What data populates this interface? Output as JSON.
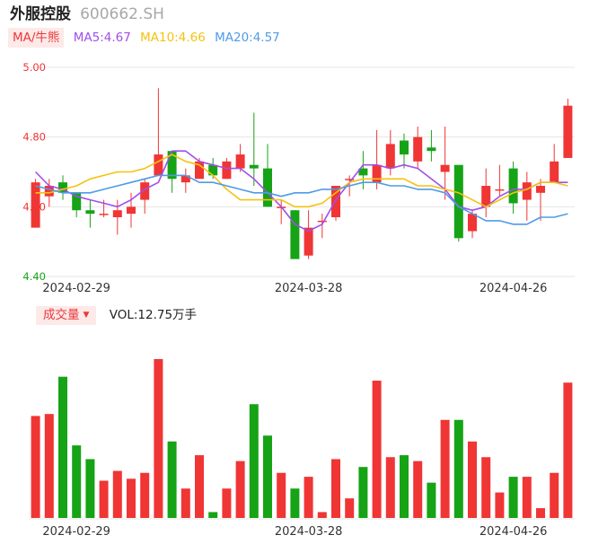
{
  "stock": {
    "name": "外服控股",
    "code": "600662.SH"
  },
  "ma_legend": {
    "button": "MA/牛熊",
    "items": [
      {
        "label": "MA5:4.67",
        "color": "#a24ee8"
      },
      {
        "label": "MA10:4.66",
        "color": "#f5c20f"
      },
      {
        "label": "MA20:4.57",
        "color": "#4e9be8"
      }
    ]
  },
  "volume_legend": {
    "button": "成交量",
    "value_text": "VOL:12.75万手"
  },
  "colors": {
    "up": "#f03535",
    "down": "#16a316",
    "grid": "#e6e6e6"
  },
  "chart_data": [
    {
      "type": "candlestick",
      "y_ticks": [
        "5.00",
        "4.80",
        "4.60",
        "4.40"
      ],
      "ylim": [
        4.4,
        5.0
      ],
      "x_ticks": [
        {
          "index": 3,
          "label": "2024-02-29"
        },
        {
          "index": 20,
          "label": "2024-03-28"
        },
        {
          "index": 35,
          "label": "2024-04-26"
        }
      ],
      "candles": [
        {
          "o": 4.54,
          "c": 4.67,
          "h": 4.68,
          "l": 4.54
        },
        {
          "o": 4.63,
          "c": 4.66,
          "h": 4.68,
          "l": 4.6
        },
        {
          "o": 4.67,
          "c": 4.64,
          "h": 4.69,
          "l": 4.62
        },
        {
          "o": 4.64,
          "c": 4.59,
          "h": 4.64,
          "l": 4.57
        },
        {
          "o": 4.59,
          "c": 4.58,
          "h": 4.62,
          "l": 4.54
        },
        {
          "o": 4.58,
          "c": 4.58,
          "h": 4.62,
          "l": 4.57
        },
        {
          "o": 4.57,
          "c": 4.59,
          "h": 4.62,
          "l": 4.52
        },
        {
          "o": 4.58,
          "c": 4.6,
          "h": 4.64,
          "l": 4.54
        },
        {
          "o": 4.62,
          "c": 4.67,
          "h": 4.68,
          "l": 4.58
        },
        {
          "o": 4.69,
          "c": 4.75,
          "h": 4.94,
          "l": 4.69
        },
        {
          "o": 4.76,
          "c": 4.68,
          "h": 4.76,
          "l": 4.64
        },
        {
          "o": 4.67,
          "c": 4.69,
          "h": 4.71,
          "l": 4.64
        },
        {
          "o": 4.68,
          "c": 4.73,
          "h": 4.74,
          "l": 4.69
        },
        {
          "o": 4.72,
          "c": 4.69,
          "h": 4.74,
          "l": 4.68
        },
        {
          "o": 4.68,
          "c": 4.73,
          "h": 4.74,
          "l": 4.68
        },
        {
          "o": 4.71,
          "c": 4.75,
          "h": 4.78,
          "l": 4.7
        },
        {
          "o": 4.72,
          "c": 4.71,
          "h": 4.87,
          "l": 4.66
        },
        {
          "o": 4.71,
          "c": 4.6,
          "h": 4.78,
          "l": 4.6
        },
        {
          "o": 4.6,
          "c": 4.6,
          "h": 4.62,
          "l": 4.55
        },
        {
          "o": 4.59,
          "c": 4.45,
          "h": 4.59,
          "l": 4.45
        },
        {
          "o": 4.46,
          "c": 4.54,
          "h": 4.59,
          "l": 4.45
        },
        {
          "o": 4.56,
          "c": 4.56,
          "h": 4.58,
          "l": 4.51
        },
        {
          "o": 4.57,
          "c": 4.66,
          "h": 4.66,
          "l": 4.56
        },
        {
          "o": 4.68,
          "c": 4.68,
          "h": 4.69,
          "l": 4.63
        },
        {
          "o": 4.71,
          "c": 4.69,
          "h": 4.76,
          "l": 4.65
        },
        {
          "o": 4.67,
          "c": 4.72,
          "h": 4.82,
          "l": 4.65
        },
        {
          "o": 4.71,
          "c": 4.78,
          "h": 4.82,
          "l": 4.69
        },
        {
          "o": 4.79,
          "c": 4.75,
          "h": 4.81,
          "l": 4.71
        },
        {
          "o": 4.73,
          "c": 4.8,
          "h": 4.83,
          "l": 4.71
        },
        {
          "o": 4.77,
          "c": 4.76,
          "h": 4.82,
          "l": 4.73
        },
        {
          "o": 4.7,
          "c": 4.72,
          "h": 4.83,
          "l": 4.62
        },
        {
          "o": 4.72,
          "c": 4.51,
          "h": 4.72,
          "l": 4.5
        },
        {
          "o": 4.53,
          "c": 4.58,
          "h": 4.59,
          "l": 4.51
        },
        {
          "o": 4.6,
          "c": 4.66,
          "h": 4.71,
          "l": 4.57
        },
        {
          "o": 4.65,
          "c": 4.65,
          "h": 4.72,
          "l": 4.63
        },
        {
          "o": 4.71,
          "c": 4.61,
          "h": 4.73,
          "l": 4.58
        },
        {
          "o": 4.62,
          "c": 4.67,
          "h": 4.7,
          "l": 4.56
        },
        {
          "o": 4.64,
          "c": 4.66,
          "h": 4.68,
          "l": 4.56
        },
        {
          "o": 4.67,
          "c": 4.73,
          "h": 4.78,
          "l": 4.67
        },
        {
          "o": 4.74,
          "c": 4.89,
          "h": 4.91,
          "l": 4.74
        }
      ],
      "ma": {
        "MA5": [
          4.7,
          4.66,
          4.65,
          4.63,
          4.62,
          4.61,
          4.6,
          4.62,
          4.65,
          4.67,
          4.76,
          4.76,
          4.73,
          4.72,
          4.71,
          4.71,
          4.68,
          4.64,
          4.6,
          4.55,
          4.53,
          4.55,
          4.62,
          4.67,
          4.72,
          4.72,
          4.71,
          4.72,
          4.71,
          4.68,
          4.65,
          4.6,
          4.59,
          4.6,
          4.63,
          4.65,
          4.65,
          4.67,
          4.67,
          4.67
        ],
        "MA10": [
          4.64,
          4.64,
          4.65,
          4.66,
          4.68,
          4.69,
          4.7,
          4.7,
          4.71,
          4.73,
          4.75,
          4.73,
          4.72,
          4.69,
          4.65,
          4.62,
          4.62,
          4.62,
          4.62,
          4.6,
          4.6,
          4.61,
          4.64,
          4.67,
          4.68,
          4.68,
          4.68,
          4.68,
          4.66,
          4.66,
          4.65,
          4.64,
          4.62,
          4.6,
          4.62,
          4.64,
          4.65,
          4.67,
          4.67,
          4.66
        ],
        "MA20": [
          4.66,
          4.65,
          4.64,
          4.64,
          4.64,
          4.65,
          4.66,
          4.67,
          4.68,
          4.69,
          4.69,
          4.69,
          4.67,
          4.67,
          4.66,
          4.65,
          4.64,
          4.64,
          4.63,
          4.64,
          4.64,
          4.65,
          4.65,
          4.66,
          4.67,
          4.67,
          4.66,
          4.66,
          4.65,
          4.65,
          4.64,
          4.6,
          4.58,
          4.56,
          4.56,
          4.55,
          4.55,
          4.57,
          4.57,
          4.58
        ]
      }
    },
    {
      "type": "bar",
      "title": "成交量",
      "volumes": [
        5.2,
        5.3,
        7.2,
        3.7,
        3.0,
        1.9,
        2.4,
        2.0,
        2.3,
        8.1,
        3.9,
        1.5,
        3.2,
        0.3,
        1.5,
        2.9,
        5.8,
        4.2,
        2.3,
        1.5,
        2.1,
        0.3,
        3.0,
        1.0,
        2.6,
        7.0,
        3.1,
        3.2,
        2.9,
        1.8,
        5.0,
        5.0,
        3.9,
        3.1,
        1.3,
        2.1,
        2.1,
        0.5,
        2.3,
        6.9
      ]
    }
  ]
}
